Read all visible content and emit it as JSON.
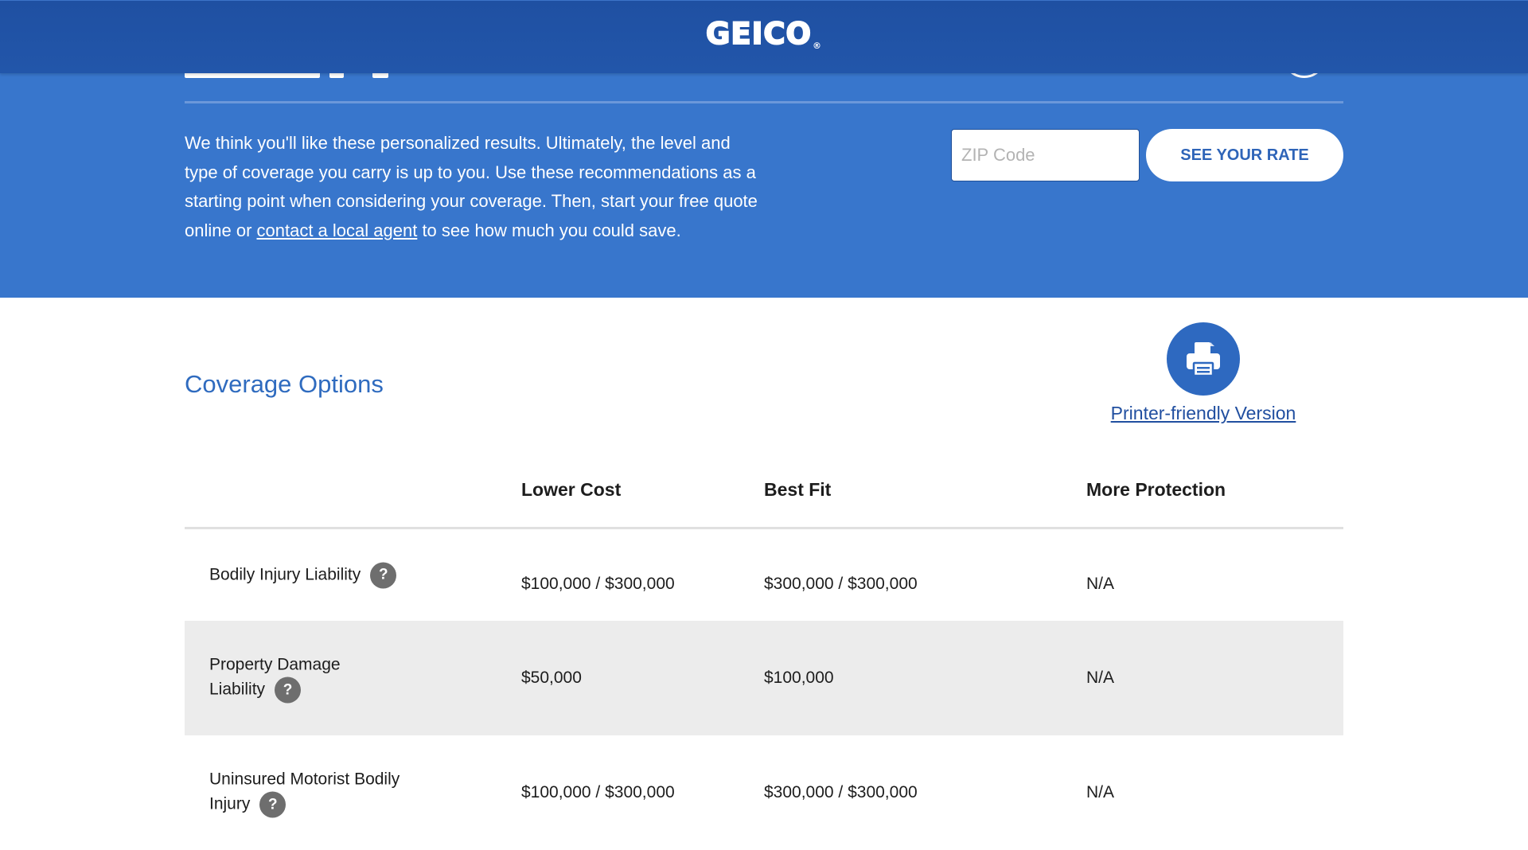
{
  "header": {
    "logo_text": "GEICO",
    "logo_mark": "®"
  },
  "hero": {
    "intro_text": "We think you'll like these personalized results. Ultimately, the level and type of coverage you carry is up to you. Use these recommendations as a starting point when considering your coverage. Then, start your free quote online or ",
    "link_text": "contact a local agent",
    "outro_text": " to see how much you could save.",
    "zip_placeholder": "ZIP Code",
    "zip_icon": "map-pin-icon",
    "cta_label": "SEE YOUR RATE"
  },
  "coverage": {
    "title": "Coverage Options",
    "print_icon": "printer-icon",
    "print_link": "Printer-friendly Version",
    "columns": [
      "Lower Cost",
      "Best Fit",
      "More Protection"
    ],
    "rows": [
      {
        "label": "Bodily Injury Liability",
        "values": [
          "$100,000 / $300,000",
          "$300,000 / $300,000",
          "N/A"
        ]
      },
      {
        "label": "Property Damage Liability",
        "values": [
          "$50,000",
          "$100,000",
          "N/A"
        ]
      },
      {
        "label": "Uninsured Motorist Bodily Injury",
        "values": [
          "$100,000 / $300,000",
          "$300,000 / $300,000",
          "N/A"
        ]
      }
    ],
    "help_glyph": "?"
  },
  "colors": {
    "header": "#2155a8",
    "hero": "#3876cc",
    "accent": "#2f6bbf",
    "row_alt": "#ececec"
  }
}
